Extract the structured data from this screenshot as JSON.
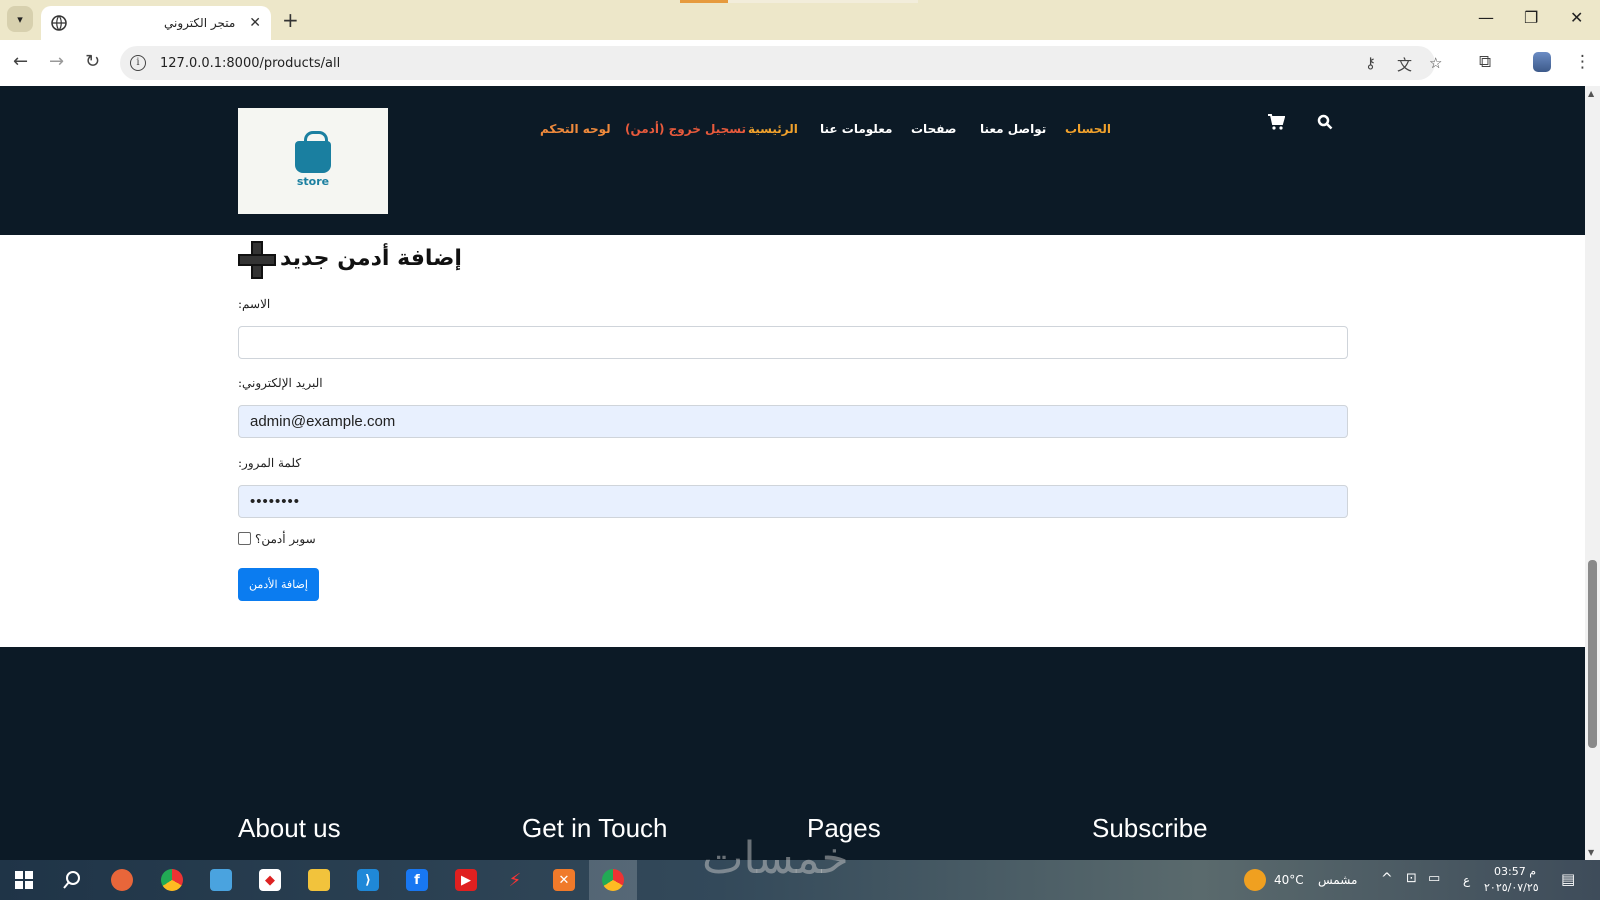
{
  "browser": {
    "tab_title": "متجر الكتروني",
    "url": "127.0.0.1:8000/products/all"
  },
  "header": {
    "logo_text": "store",
    "menu": [
      {
        "label": "لوحه التحكم",
        "color": "#f08a3c"
      },
      {
        "label": "تسجيل خروج (أدمن)",
        "color": "#e85a3c"
      },
      {
        "label": "الرئيسية",
        "color": "#f0a12c"
      },
      {
        "label": "معلومات عنا",
        "color": "#ffffff"
      },
      {
        "label": "صفحات",
        "color": "#ffffff"
      },
      {
        "label": "تواصل معنا",
        "color": "#ffffff"
      },
      {
        "label": "الحساب",
        "color": "#f0a12c"
      }
    ]
  },
  "form": {
    "title": "إضافة أدمن جديد",
    "name_label": ":الاسم",
    "name_value": "",
    "email_label": ":البريد الإلكتروني",
    "email_value": "admin@example.com",
    "password_label": ":كلمة المرور",
    "password_value": "••••••••",
    "super_admin_label": "سوبر أدمن؟",
    "super_admin_checked": false,
    "submit_label": "إضافة الأدمن"
  },
  "footer": {
    "headings": [
      "About us",
      "Get in Touch",
      "Pages",
      "Subscribe"
    ]
  },
  "taskbar": {
    "weather_temp": "40°C",
    "weather_text": "مشمس",
    "lang": "ع",
    "time": "03:57 م",
    "date": "٢٠٢٥/٠٧/٢٥",
    "watermark": "خمسات"
  },
  "colors": {
    "header_bg": "#0c1a26",
    "primary_button": "#0b7cf0",
    "autofill_bg": "#e8f0fe"
  }
}
